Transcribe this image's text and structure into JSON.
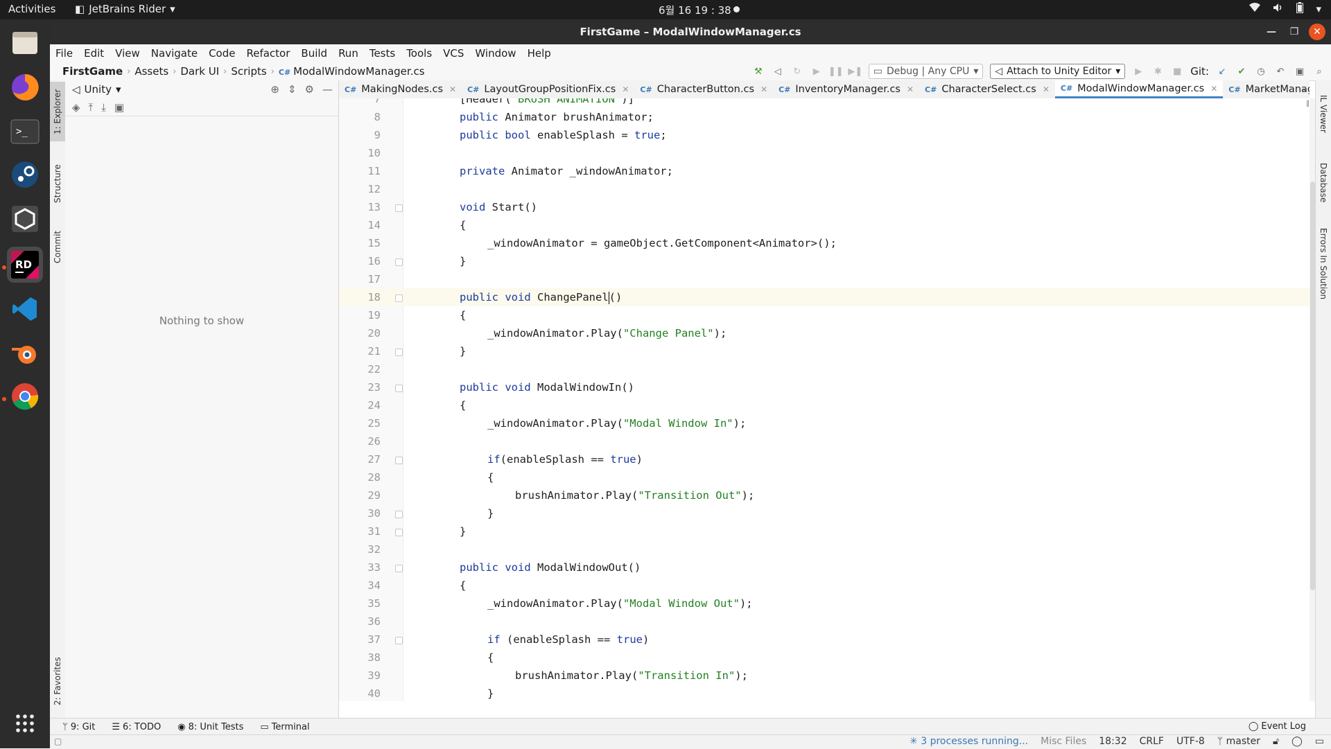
{
  "topbar": {
    "activities": "Activities",
    "app_name": "JetBrains Rider",
    "clock": "6월 16 19 : 38"
  },
  "window": {
    "title": "FirstGame – ModalWindowManager.cs"
  },
  "menu": [
    "File",
    "Edit",
    "View",
    "Navigate",
    "Code",
    "Refactor",
    "Build",
    "Run",
    "Tests",
    "Tools",
    "VCS",
    "Window",
    "Help"
  ],
  "breadcrumb": {
    "items": [
      "FirstGame",
      "Assets",
      "Dark UI",
      "Scripts"
    ],
    "file_tag": "C#",
    "file": "ModalWindowManager.cs"
  },
  "toolbar": {
    "config": "Debug | Any CPU",
    "attach": "Attach to Unity Editor",
    "git_label": "Git:"
  },
  "left_stripe": {
    "explorer": "1: Explorer",
    "structure": "Structure",
    "commit": "Commit",
    "favorites": "2: Favorites"
  },
  "explorer": {
    "view": "Unity",
    "empty_text": "Nothing to show"
  },
  "tabs": [
    {
      "tag": "C#",
      "label": "MakingNodes.cs"
    },
    {
      "tag": "C#",
      "label": "LayoutGroupPositionFix.cs"
    },
    {
      "tag": "C#",
      "label": "CharacterButton.cs"
    },
    {
      "tag": "C#",
      "label": "InventoryManager.cs"
    },
    {
      "tag": "C#",
      "label": "CharacterSelect.cs"
    },
    {
      "tag": "C#",
      "label": "ModalWindowManager.cs"
    },
    {
      "tag": "C#",
      "label": "MarketManager.cs"
    },
    {
      "tag": "C#",
      "label": ""
    }
  ],
  "editor": {
    "lines": [
      {
        "n": "7",
        "t": "[Header(\"BRUSH ANIMATION\")]"
      },
      {
        "n": "8",
        "t": "public Animator brushAnimator;"
      },
      {
        "n": "9",
        "t": "public bool enableSplash = true;"
      },
      {
        "n": "10",
        "t": ""
      },
      {
        "n": "11",
        "t": "private Animator _windowAnimator;"
      },
      {
        "n": "12",
        "t": ""
      },
      {
        "n": "13",
        "t": "void Start()"
      },
      {
        "n": "14",
        "t": "{"
      },
      {
        "n": "15",
        "t": "_windowAnimator = gameObject.GetComponent<Animator>();"
      },
      {
        "n": "16",
        "t": "}"
      },
      {
        "n": "17",
        "t": ""
      },
      {
        "n": "18",
        "t": "public void ChangePanel()"
      },
      {
        "n": "19",
        "t": "{"
      },
      {
        "n": "20",
        "t": "_windowAnimator.Play(\"Change Panel\");"
      },
      {
        "n": "21",
        "t": "}"
      },
      {
        "n": "22",
        "t": ""
      },
      {
        "n": "23",
        "t": "public void ModalWindowIn()"
      },
      {
        "n": "24",
        "t": "{"
      },
      {
        "n": "25",
        "t": "_windowAnimator.Play(\"Modal Window In\");"
      },
      {
        "n": "26",
        "t": ""
      },
      {
        "n": "27",
        "t": "if(enableSplash == true)"
      },
      {
        "n": "28",
        "t": "{"
      },
      {
        "n": "29",
        "t": "brushAnimator.Play(\"Transition Out\");"
      },
      {
        "n": "30",
        "t": "}"
      },
      {
        "n": "31",
        "t": "}"
      },
      {
        "n": "32",
        "t": ""
      },
      {
        "n": "33",
        "t": "public void ModalWindowOut()"
      },
      {
        "n": "34",
        "t": "{"
      },
      {
        "n": "35",
        "t": "_windowAnimator.Play(\"Modal Window Out\");"
      },
      {
        "n": "36",
        "t": ""
      },
      {
        "n": "37",
        "t": "if (enableSplash == true)"
      },
      {
        "n": "38",
        "t": "{"
      },
      {
        "n": "39",
        "t": "brushAnimator.Play(\"Transition In\");"
      },
      {
        "n": "40",
        "t": "}"
      }
    ]
  },
  "right_stripe": {
    "il_viewer": "IL Viewer",
    "database": "Database",
    "errors": "Errors In Solution"
  },
  "bottom_tools": {
    "git": "9: Git",
    "todo": "6: TODO",
    "unit_tests": "8: Unit Tests",
    "terminal": "Terminal",
    "event_log": "Event Log"
  },
  "status": {
    "processes": "3 processes running...",
    "context": "Misc Files",
    "position": "18:32",
    "line_ending": "CRLF",
    "encoding": "UTF-8",
    "branch": "master"
  }
}
